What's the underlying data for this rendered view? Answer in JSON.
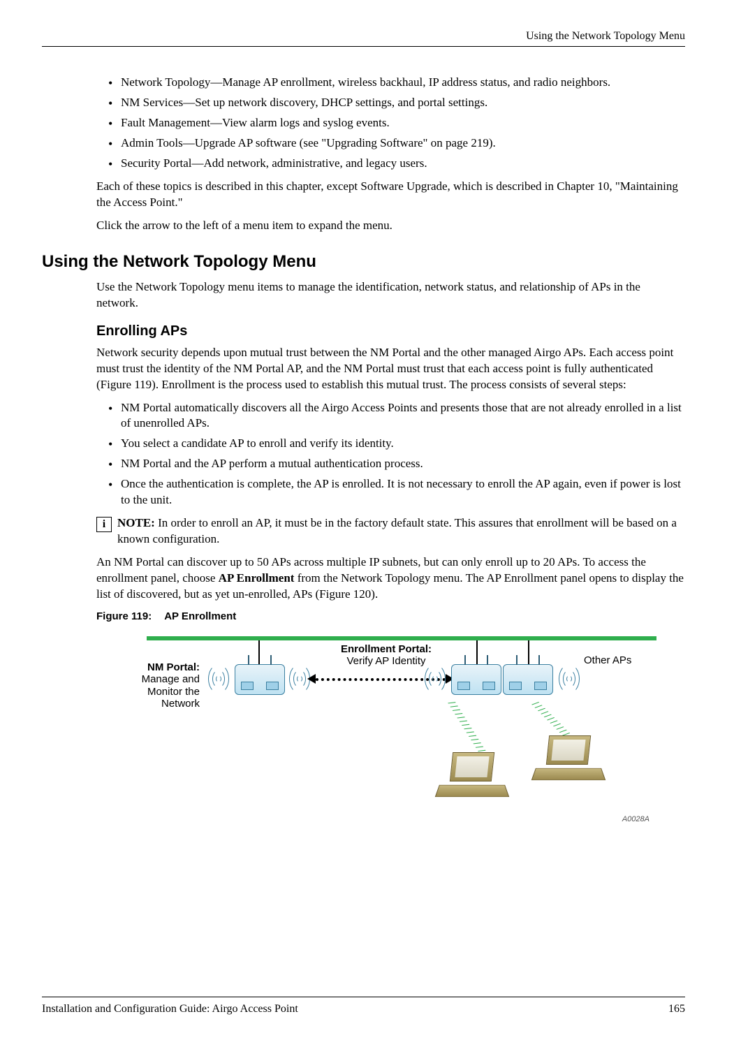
{
  "header": {
    "section": "Using the Network Topology Menu"
  },
  "top_list": {
    "items": [
      "Network Topology—Manage AP enrollment, wireless backhaul, IP address status, and radio neighbors.",
      "NM Services—Set up network discovery, DHCP settings, and portal settings.",
      "Fault Management—View alarm logs and syslog events.",
      "Admin Tools—Upgrade AP software (see \"Upgrading Software\" on page 219).",
      "Security Portal—Add network, administrative, and legacy users."
    ]
  },
  "paras": {
    "p1": "Each of these topics is described in this chapter, except Software Upgrade, which is described in Chapter 10,  \"Maintaining the Access Point.\"",
    "p2": "Click the arrow to the left of a menu item to expand the menu."
  },
  "h1": "Using the Network Topology Menu",
  "p3": "Use the Network Topology menu items to manage the identification, network status, and relationship of APs in the network.",
  "h2": "Enrolling APs",
  "p4": "Network security depends upon mutual trust between the NM Portal and the other managed Airgo APs. Each access point must trust the identity of the NM Portal AP, and the NM Portal must trust that each access point is fully authenticated (Figure 119). Enrollment is the process used to establish this mutual trust. The process consists of several steps:",
  "enroll_steps": {
    "items": [
      "NM Portal automatically discovers all the Airgo Access Points and presents those that are not already enrolled in a list of unenrolled APs.",
      "You select a candidate AP to enroll and verify its identity.",
      "NM Portal and the AP perform a mutual authentication process.",
      "Once the authentication is complete, the AP is enrolled. It is not necessary to enroll the AP again, even if power is lost to the unit."
    ]
  },
  "note": {
    "label": "NOTE:",
    "text": "In order to enroll an AP, it must be in the factory default state. This assures that enrollment will be based on a known configuration.",
    "icon_glyph": "i"
  },
  "p5_parts": {
    "a": "An NM Portal can discover up to 50 APs across multiple IP subnets, but can only enroll up to 20 APs. To access the enrollment panel, choose ",
    "b_bold": "AP Enrollment",
    "c": " from the Network Topology menu. The AP Enrollment panel opens to display the list of discovered, but as yet un-enrolled, APs (Figure 120)."
  },
  "figure": {
    "caption_prefix": "Figure 119:",
    "caption_title": "AP Enrollment",
    "nm_title": "NM Portal:",
    "nm_sub": "Manage and Monitor the Network",
    "ep_title": "Enrollment Portal:",
    "ep_sub": "Verify AP Identity",
    "other": "Other APs",
    "id": "A0028A"
  },
  "footer": {
    "left": "Installation and Configuration Guide: Airgo Access Point",
    "right": "165"
  }
}
